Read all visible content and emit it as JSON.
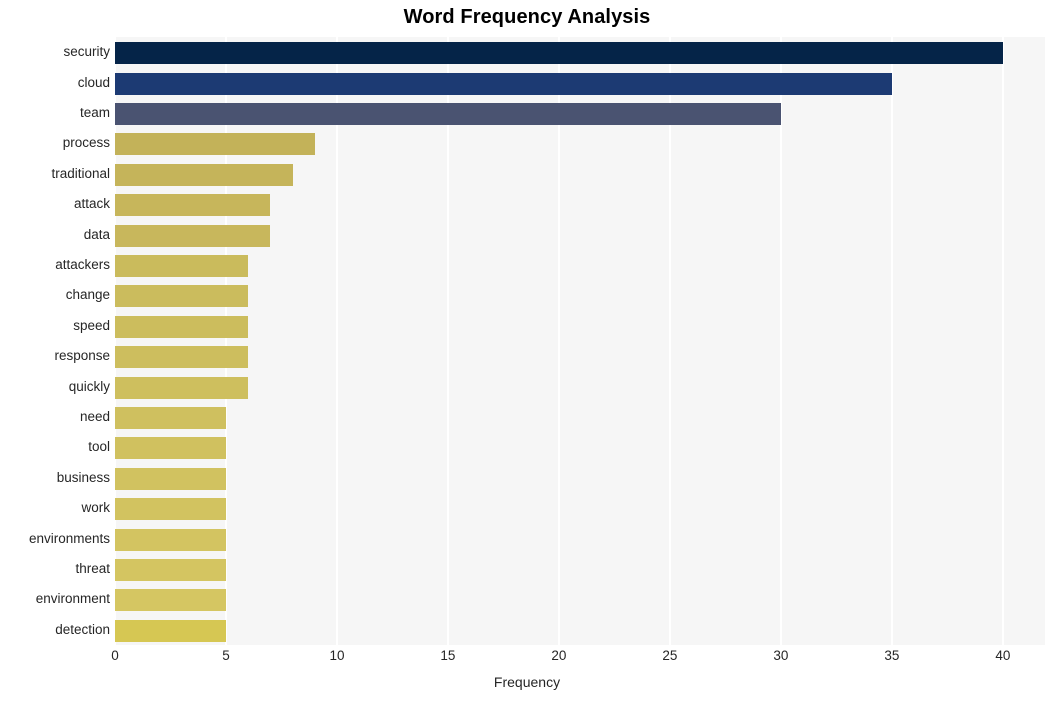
{
  "chart_data": {
    "type": "bar",
    "orientation": "horizontal",
    "title": "Word Frequency Analysis",
    "xlabel": "Frequency",
    "ylabel": "",
    "xlim": [
      0,
      41.9
    ],
    "xticks": [
      0,
      5,
      10,
      15,
      20,
      25,
      30,
      35,
      40
    ],
    "xtick_labels": [
      "0",
      "5",
      "10",
      "15",
      "20",
      "25",
      "30",
      "35",
      "40"
    ],
    "grid": true,
    "grid_axis": "x",
    "legend": null,
    "categories": [
      "security",
      "cloud",
      "team",
      "process",
      "traditional",
      "attack",
      "data",
      "attackers",
      "change",
      "speed",
      "response",
      "quickly",
      "need",
      "tool",
      "business",
      "work",
      "environments",
      "threat",
      "environment",
      "detection"
    ],
    "values": [
      40,
      35,
      30,
      9,
      8,
      7,
      7,
      6,
      6,
      6,
      6,
      6,
      5,
      5,
      5,
      5,
      5,
      5,
      5,
      5
    ],
    "bar_colors": [
      "#052448",
      "#1c3a73",
      "#4a5371",
      "#c3b259",
      "#c5b45a",
      "#c7b65b",
      "#c8b75c",
      "#cabb5c",
      "#cbbc5d",
      "#ccbd5d",
      "#cdbe5e",
      "#cebf5e",
      "#cfc05f",
      "#d0c15f",
      "#d1c260",
      "#d2c360",
      "#d3c461",
      "#d4c561",
      "#d5c662",
      "#d6c753"
    ],
    "plot_background": "#f6f6f6",
    "grid_color": "#ffffff",
    "figure_background": "#ffffff",
    "text_color": "#262626",
    "title_color": "#000000"
  }
}
